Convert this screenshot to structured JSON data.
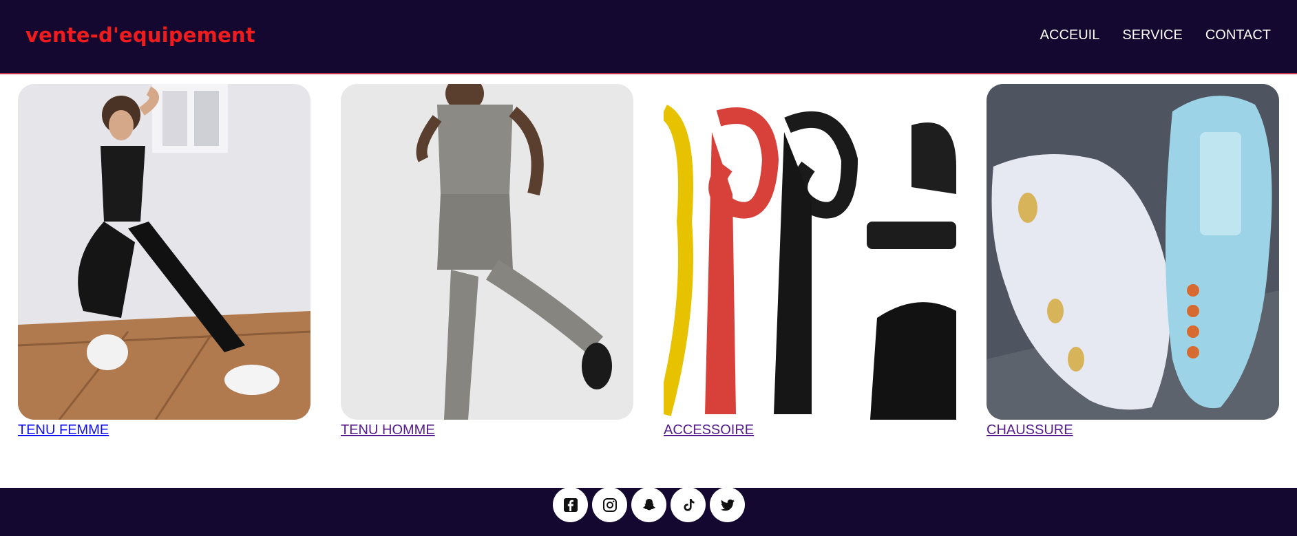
{
  "header": {
    "brand": "vente-d'equipement",
    "nav": [
      {
        "label": "ACCEUIL"
      },
      {
        "label": "SERVICE"
      },
      {
        "label": "CONTACT"
      }
    ]
  },
  "categories": [
    {
      "label": "TENU FEMME",
      "link_color": "#1010ee"
    },
    {
      "label": "TENU HOMME",
      "link_color": "#551a8b"
    },
    {
      "label": "ACCESSOIRE",
      "link_color": "#551a8b"
    },
    {
      "label": "CHAUSSURE",
      "link_color": "#551a8b"
    }
  ],
  "footer": {
    "socials": [
      {
        "icon": "facebook-icon"
      },
      {
        "icon": "instagram-icon"
      },
      {
        "icon": "snapchat-icon"
      },
      {
        "icon": "tiktok-icon"
      },
      {
        "icon": "twitter-icon"
      }
    ]
  },
  "colors": {
    "header_bg": "#140830",
    "brand": "#ee1c1c",
    "footer_bg": "#140830"
  }
}
